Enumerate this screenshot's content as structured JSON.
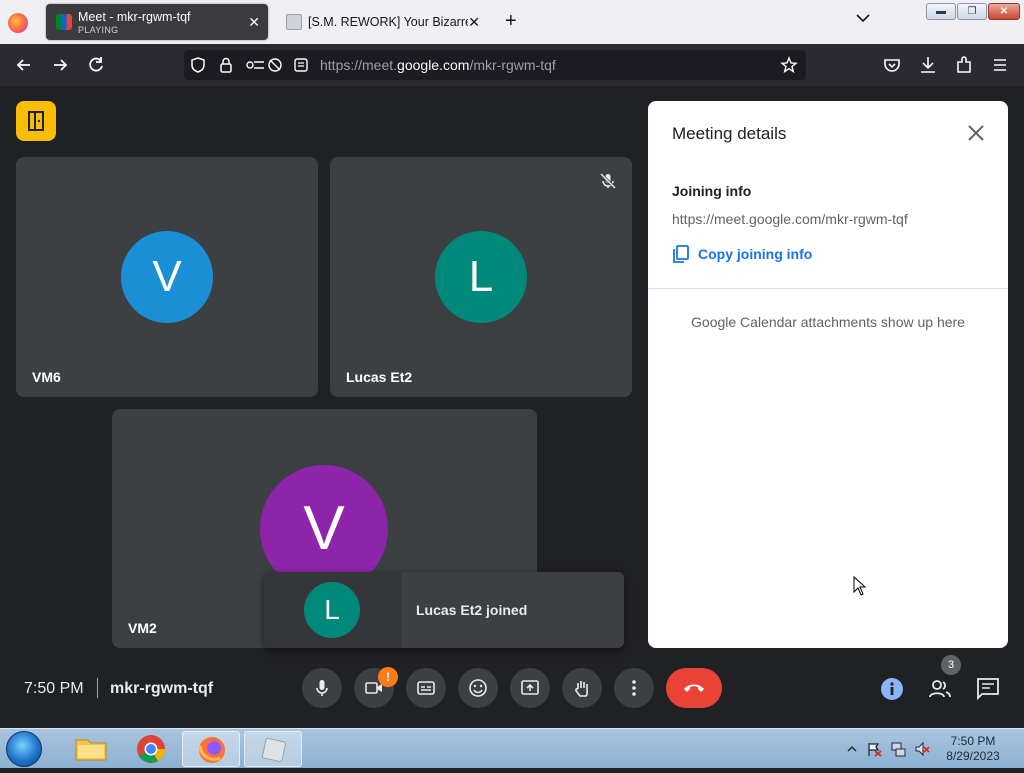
{
  "browser": {
    "tabs": [
      {
        "title": "Meet - mkr-rgwm-tqf",
        "subtitle": "PLAYING",
        "favicon": "google-meet-icon",
        "active": true
      },
      {
        "title": "[S.M. REWORK] Your Bizarre Adventure",
        "favicon": "document-icon",
        "active": false
      }
    ],
    "url_prefix": "https://meet.",
    "url_host": "google.com",
    "url_path": "/mkr-rgwm-tqf"
  },
  "meet": {
    "participants": [
      {
        "initial": "V",
        "name": "VM6",
        "color": "#1a8fd6"
      },
      {
        "initial": "L",
        "name": "Lucas Et2",
        "color": "#00897b",
        "muted": true
      },
      {
        "initial": "V",
        "name": "VM2",
        "color": "#8e24aa"
      }
    ],
    "toast": {
      "initial": "L",
      "message": "Lucas Et2 joined"
    },
    "clock": "7:50 PM",
    "meeting_code": "mkr-rgwm-tqf",
    "camera_warning": "!",
    "people_count": "3"
  },
  "panel": {
    "title": "Meeting details",
    "joining_label": "Joining info",
    "joining_url": "https://meet.google.com/mkr-rgwm-tqf",
    "copy_label": "Copy joining info",
    "calendar_note": "Google Calendar attachments show up here"
  },
  "taskbar": {
    "time": "7:50 PM",
    "date": "8/29/2023",
    "apps": [
      "file-explorer-icon",
      "chrome-icon",
      "firefox-icon",
      "app-icon"
    ]
  },
  "colors": {
    "accent": "#1a73e8",
    "end_call": "#ea4335",
    "leave": "#fbbc04"
  }
}
